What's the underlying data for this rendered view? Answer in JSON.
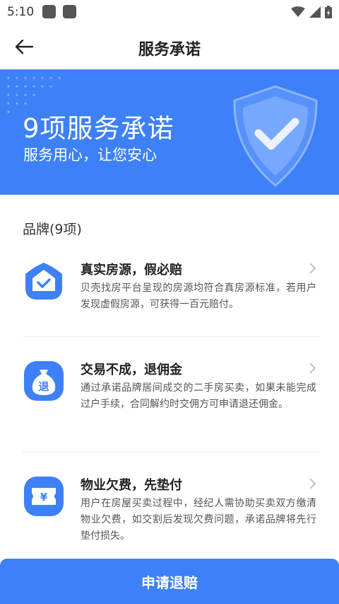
{
  "status_bar": {
    "time": "5:10"
  },
  "header": {
    "title": "服务承诺"
  },
  "banner": {
    "title": "9项服务承诺",
    "subtitle": "服务用心，让您安心"
  },
  "section": {
    "title": "品牌(9项)"
  },
  "items": [
    {
      "title": "真实房源，假必赔",
      "description": "贝壳找房平台呈现的房源均符合真房源标准，若用户发现虚假房源，可获得一百元赔付。",
      "icon": "house-check-icon"
    },
    {
      "title": "交易不成，退佣金",
      "description": "通过承诺品牌居间成交的二手房买卖，如果未能完成过户手续，合同解约时交佣方可申请退还佣金。",
      "icon": "money-bag-icon",
      "icon_text": "退"
    },
    {
      "title": "物业欠费，先垫付",
      "description": "用户在房屋买卖过程中，经纪人需协助买卖双方缴清物业欠费，如交割后发现欠费问题，承诺品牌将先行垫付损失。",
      "icon": "ticket-yen-icon",
      "icon_text": "¥"
    }
  ],
  "footer": {
    "button_label": "申请退赔"
  },
  "colors": {
    "primary": "#3d80f8",
    "text": "#222222",
    "desc": "#555555"
  }
}
